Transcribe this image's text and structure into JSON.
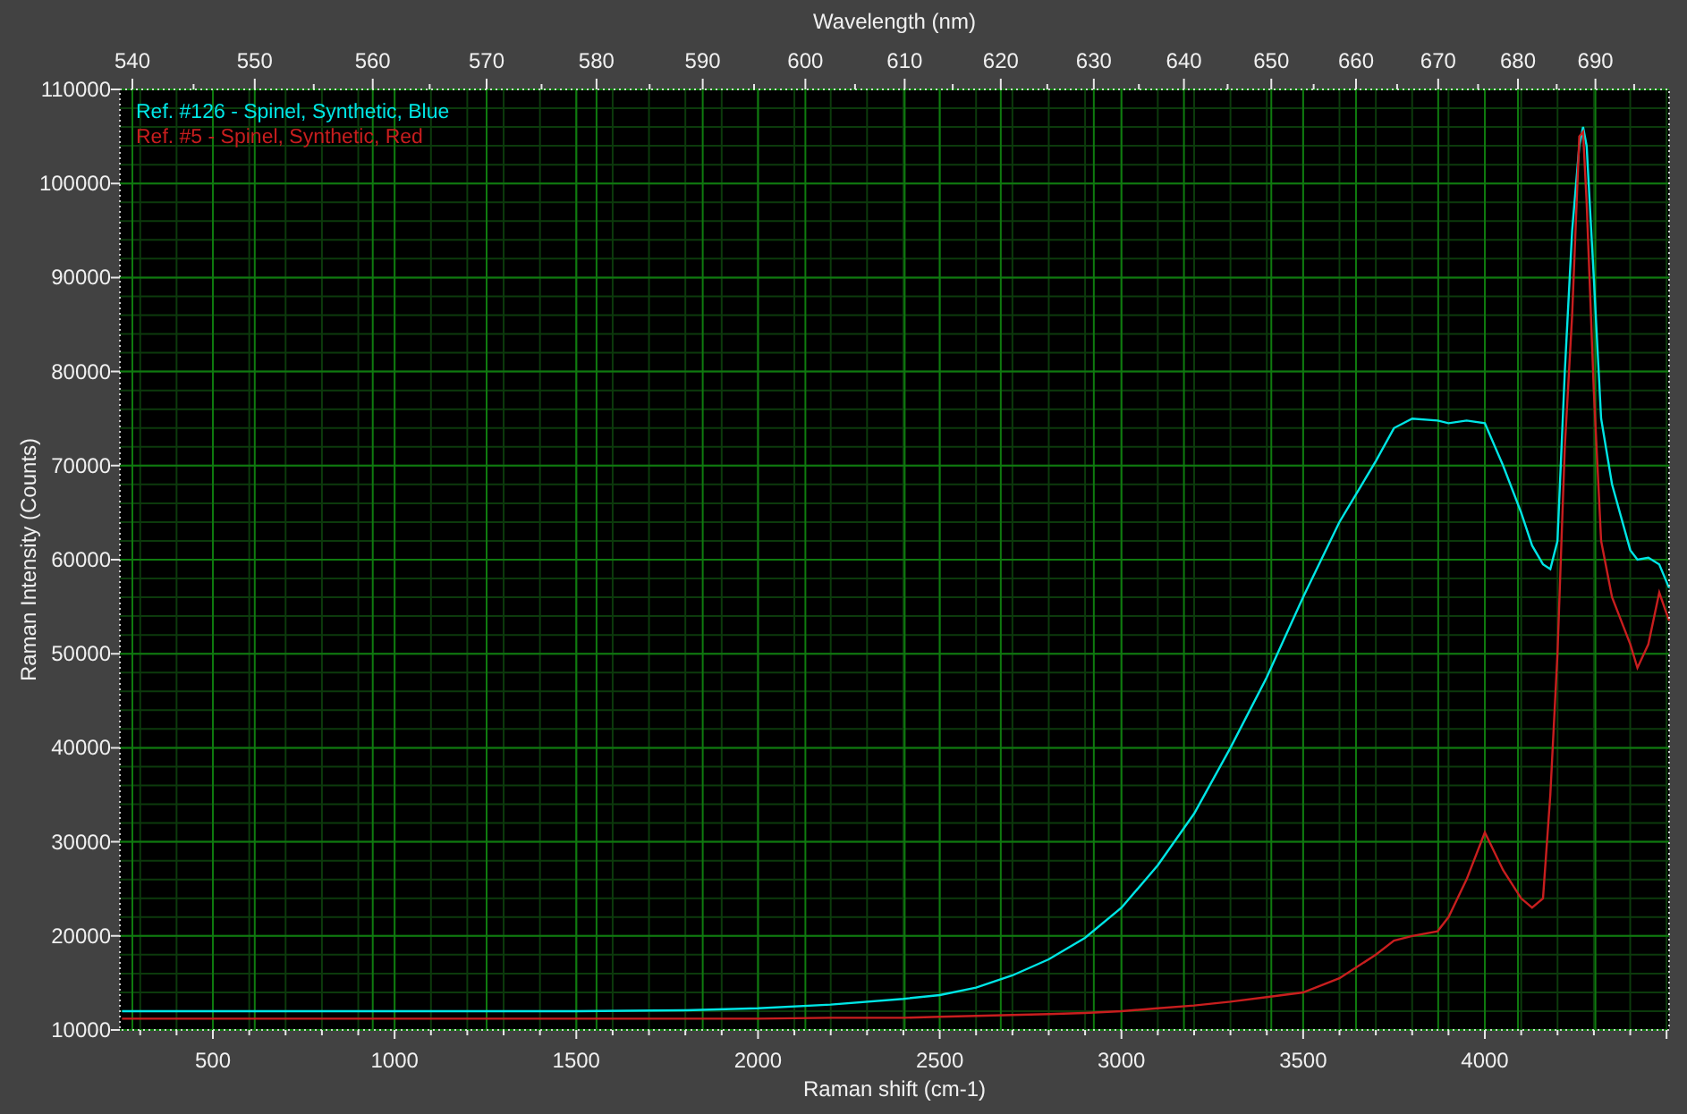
{
  "chart": {
    "top_axis": {
      "label": "Wavelength (nm)",
      "ticks": [
        "540",
        "550",
        "560",
        "570",
        "580",
        "590",
        "600",
        "610",
        "620",
        "630",
        "640",
        "650",
        "660",
        "670",
        "680",
        "690"
      ]
    },
    "chart_data": {
      "type": "line",
      "grid": true,
      "xlabel": "Raman shift (cm-1)",
      "ylabel": "Raman Intensity (Counts)",
      "xlim": [
        244,
        4507
      ],
      "ylim": [
        10000,
        110000
      ],
      "xticks": [
        500,
        1000,
        1500,
        2000,
        2500,
        3000,
        3500,
        4000
      ],
      "yticks": [
        10000,
        20000,
        30000,
        40000,
        50000,
        60000,
        70000,
        80000,
        90000,
        100000,
        110000
      ],
      "x": [
        250,
        1000,
        1500,
        1800,
        2000,
        2200,
        2400,
        2500,
        2600,
        2700,
        2800,
        2900,
        3000,
        3100,
        3200,
        3300,
        3400,
        3500,
        3600,
        3700,
        3750,
        3800,
        3870,
        3900,
        3950,
        4000,
        4050,
        4100,
        4130,
        4160,
        4180,
        4200,
        4220,
        4240,
        4260,
        4270,
        4280,
        4300,
        4320,
        4350,
        4400,
        4420,
        4450,
        4480,
        4507
      ],
      "series": [
        {
          "name": "Ref. #126 - Spinel, Synthetic, Blue",
          "color": "#00e5e5",
          "values": [
            12000,
            12000,
            12000,
            12100,
            12300,
            12700,
            13300,
            13700,
            14500,
            15800,
            17500,
            19800,
            23000,
            27500,
            33000,
            40000,
            47500,
            56000,
            64000,
            70500,
            74000,
            75000,
            74800,
            74500,
            74800,
            74500,
            70000,
            65000,
            61500,
            59500,
            59000,
            62000,
            80000,
            95000,
            104000,
            106000,
            104000,
            90000,
            75000,
            68000,
            61000,
            60000,
            60200,
            59500,
            57000
          ]
        },
        {
          "name": "Ref. #5 - Spinel, Synthetic, Red",
          "color": "#c81e1e",
          "values": [
            11200,
            11200,
            11200,
            11200,
            11200,
            11300,
            11300,
            11400,
            11500,
            11600,
            11700,
            11800,
            12000,
            12300,
            12600,
            13000,
            13500,
            14000,
            15500,
            18000,
            19500,
            20000,
            20500,
            22000,
            26000,
            31000,
            27000,
            24000,
            23000,
            24000,
            35000,
            50000,
            72000,
            86000,
            105000,
            105500,
            98000,
            78000,
            62000,
            56000,
            51000,
            48500,
            51000,
            56500,
            53500
          ]
        }
      ]
    }
  }
}
